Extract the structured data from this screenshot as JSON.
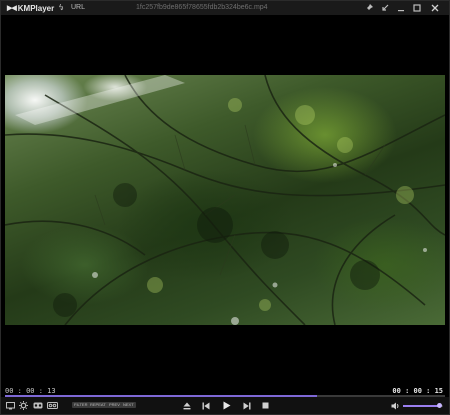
{
  "app": {
    "brand": "KMPlayer",
    "url_label": "URL",
    "file_title": "1fc257fb9de865f78655fdb2b324be6c.mp4"
  },
  "title_bar_icons": [
    "logo-icon",
    "chevron-down-icon",
    "lightning-icon",
    "pin-icon",
    "shrink-icon",
    "minimize-icon",
    "maximize-icon",
    "close-icon"
  ],
  "playback": {
    "current_time": "00 : 00 : 13",
    "total_time": "00 : 00 : 15",
    "progress_fraction": 0.71,
    "volume_fraction": 0.92
  },
  "controls": {
    "badges": [
      "FILTER",
      "REPEAT",
      "PREV",
      "NEXT"
    ],
    "buttons": [
      "eject",
      "previous",
      "play",
      "next",
      "stop"
    ]
  },
  "colors": {
    "accent": "#7e68d6",
    "volume_accent": "#9b7ff0",
    "background": "#000000",
    "titlebar": "#1a1a1a"
  }
}
